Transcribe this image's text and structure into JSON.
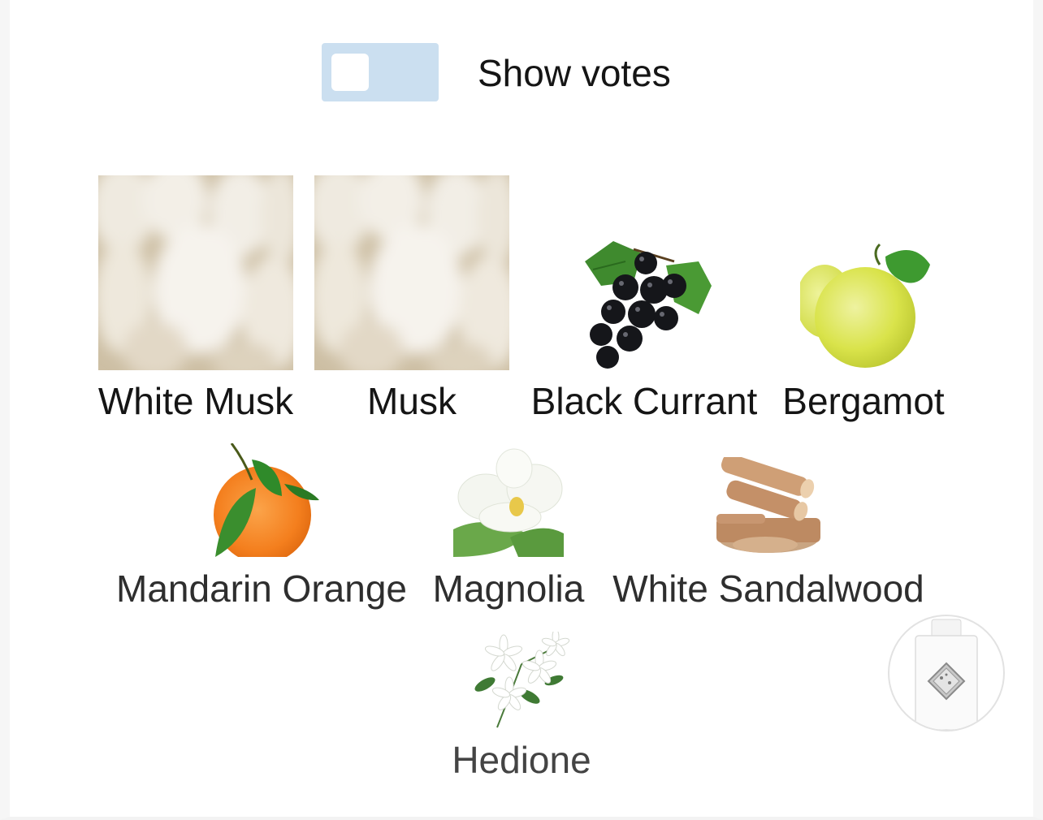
{
  "toggle": {
    "label": "Show votes",
    "checked": false,
    "color": "#cbdff0"
  },
  "notes": {
    "row1": [
      {
        "name": "White Musk",
        "icon": "white-musk-image"
      },
      {
        "name": "Musk",
        "icon": "musk-image"
      },
      {
        "name": "Black Currant",
        "icon": "black-currant-image"
      },
      {
        "name": "Bergamot",
        "icon": "bergamot-image"
      }
    ],
    "row2": [
      {
        "name": "Mandarin Orange",
        "icon": "mandarin-orange-image"
      },
      {
        "name": "Magnolia",
        "icon": "magnolia-image"
      },
      {
        "name": "White Sandalwood",
        "icon": "white-sandalwood-image"
      }
    ],
    "row3": [
      {
        "name": "Hedione",
        "icon": "hedione-image"
      }
    ]
  },
  "perfume_thumbnail": {
    "icon": "perfume-bottle-icon"
  }
}
